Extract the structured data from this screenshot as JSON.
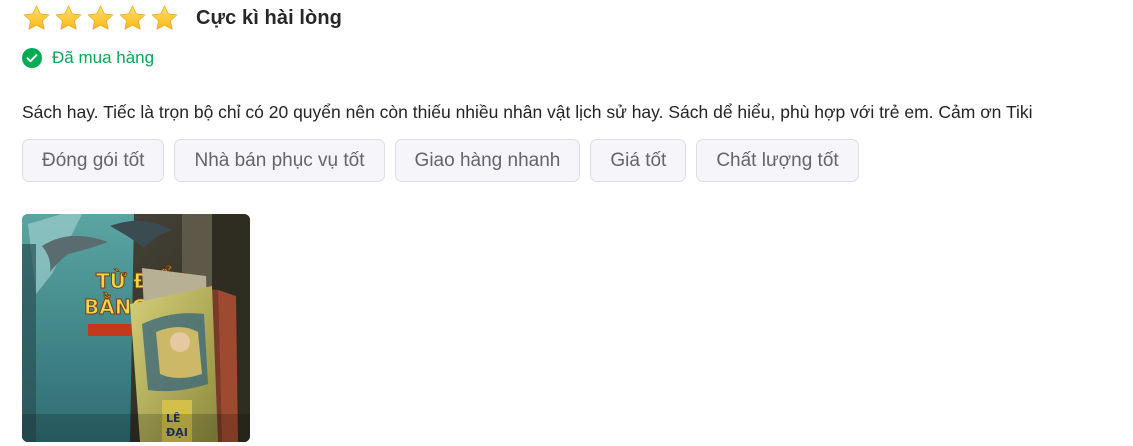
{
  "review": {
    "rating": 5,
    "rating_max": 5,
    "rating_title": "Cực kì hài lòng",
    "purchased_label": "Đã mua hàng",
    "text": "Sách hay. Tiếc là trọn bộ chỉ có 20 quyển nên còn thiếu nhiều nhân vật lịch sử hay. Sách dể hiểu, phù hợp với trẻ em. Cảm ơn Tiki",
    "tags": [
      "Đóng gói tốt",
      "Nhà bán phục vụ tốt",
      "Giao hàng nhanh",
      "Giá tốt",
      "Chất lượng tốt"
    ],
    "photo_icon": "review-photo",
    "colors": {
      "star": "#fdd836",
      "purchased": "#00ab56",
      "tag_bg": "#f5f5fa",
      "tag_border": "#dddde3",
      "tag_text": "#64646d"
    }
  }
}
